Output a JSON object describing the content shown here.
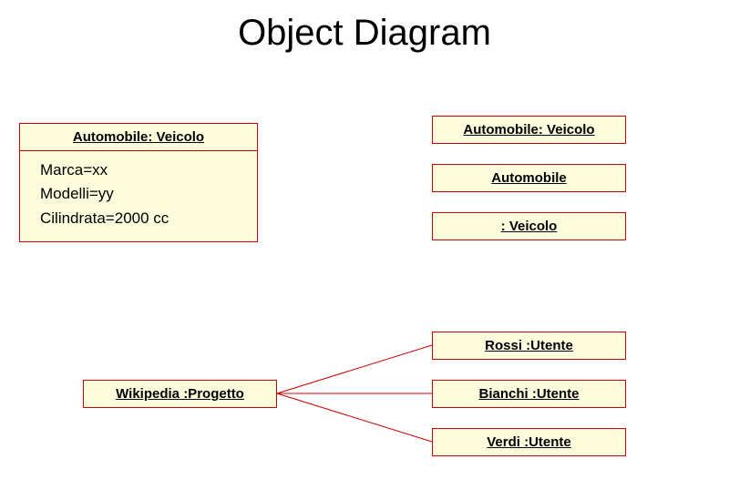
{
  "title": "Object Diagram",
  "mainObject": {
    "header": "Automobile: Veicolo",
    "attrs": [
      "Marca=xx",
      "Modelli=yy",
      "Cilindrata=2000 cc"
    ]
  },
  "sideBoxes": {
    "a": "Automobile: Veicolo",
    "b": "Automobile",
    "c": ": Veicolo"
  },
  "project": "Wikipedia :Progetto",
  "users": {
    "u1": "Rossi :Utente",
    "u2": "Bianchi :Utente",
    "u3": "Verdi :Utente"
  },
  "colors": {
    "boxFill": "#fdfcdc",
    "boxBorder": "#cc0000"
  }
}
